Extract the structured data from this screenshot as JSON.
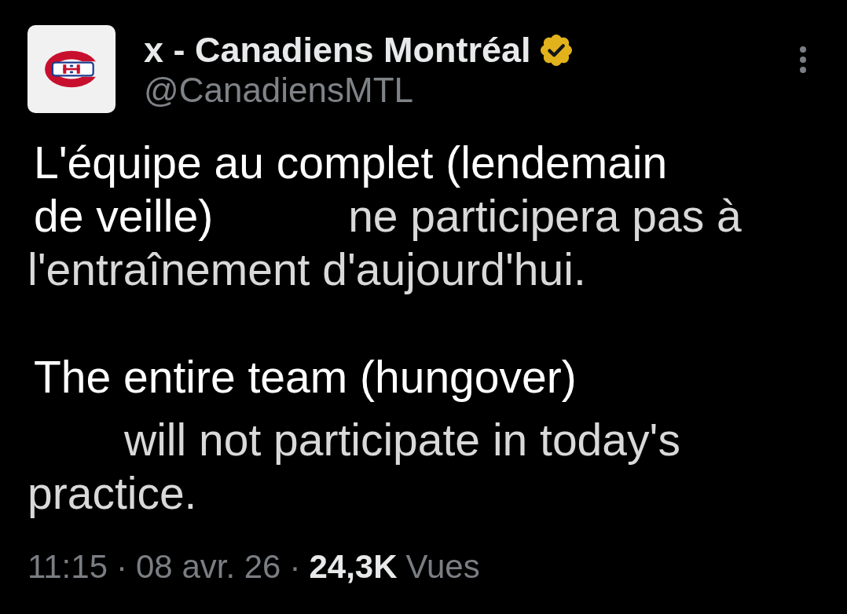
{
  "author": {
    "display_name": "x - Canadiens Montréal",
    "verified": true,
    "handle": "@CanadiensMTL"
  },
  "post": {
    "paragraphs": [
      {
        "lines": [
          {
            "segments": [
              {
                "text": "L'équipe au complet (lendemain",
                "bright": true
              }
            ]
          },
          {
            "segments": [
              {
                "text": "de veille)",
                "bright": true
              },
              {
                "text": "ne participera pas à",
                "bright": false
              }
            ]
          },
          {
            "segments": [
              {
                "text": "l'entraînement d'aujourd'hui.",
                "bright": false
              }
            ]
          }
        ]
      },
      {
        "lines": [
          {
            "segments": [
              {
                "text": "The entire team (hungover)",
                "bright": true
              }
            ]
          },
          {
            "segments": [
              {
                "text": "will not participate in today's",
                "bright": false
              }
            ]
          },
          {
            "segments": [
              {
                "text": "practice.",
                "bright": false
              }
            ]
          }
        ]
      }
    ]
  },
  "meta": [
    {
      "text": "11:15",
      "kind": "time"
    },
    {
      "text": "·",
      "kind": "separator"
    },
    {
      "text": "08 avr. 26",
      "kind": "date"
    },
    {
      "text": "·",
      "kind": "separator"
    },
    {
      "text": "24,3K",
      "kind": "count"
    },
    {
      "text": "Vues",
      "kind": "label"
    }
  ]
}
